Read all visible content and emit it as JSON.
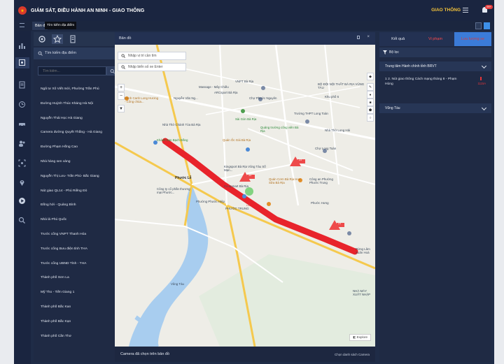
{
  "app": {
    "title": "GIÁM SÁT, ĐIỀU HÀNH AN NINH - GIAO THÔNG",
    "mode_label": "GIAO THÔNG",
    "notification_badge": "99+",
    "colors": {
      "bg": "#1f2c47",
      "accent": "#3b7bd8",
      "route": "#e8232b",
      "warning": "#e8363a"
    }
  },
  "subbar": {
    "tab_map_label": "Bản đ",
    "tab_tooltip": "Tìm kiếm địa điểm"
  },
  "list_panel": {
    "header_label": "Tìm kiếm địa điểm",
    "search_placeholder": "Tìm kiếm...",
    "items": [
      "Ngã tư Xô Viết mới, Phường Trần Phú",
      "Đường Huỳnh Thúc Kháng Hà Nội",
      "Nguyễn Thái Học Hà Giang",
      "Camera đường Quyết Thắng - Hà Giang",
      "Đường Phạm Hồng Cao",
      "Nhà hàng sen vàng",
      "Nguyễn Thị Lưu- Trần Phú- Bắc Giang",
      "Nút giao QL14 - Phú Riềng Đỏ",
      "Đồng hới - Quảng Bình",
      "Nhà lá Phú Quốc",
      "Trước cổng VNPT Thanh Hóa",
      "Trước cổng Bưu điện tỉnh THA",
      "Trước cổng UBND Tỉnh - THA",
      "Thành phố Sơn La",
      "Mỹ Tho - Tiền Giang 1",
      "Thành phố Bắc Kan",
      "Thành phố Bắc Kạn",
      "Thành phố Cần Thơ"
    ]
  },
  "map_panel": {
    "title": "Bản đồ",
    "search_location_placeholder": "Nhập vị trí cần tìm",
    "search_plate_placeholder": "Nhập biển số xe Enter",
    "footer_text": "Camera đã chọn trên bản đồ",
    "footer_link": "Chọn danh sách Camera",
    "explore_label": "Explore",
    "labels": {
      "massage": "Massage - Mây Chiều",
      "arcsport": "ARCsport Bà Rịa",
      "vnpt": "VNPT Bà Rịa",
      "bo_doi": "BỘ ĐỘI NỘI THẤT BÀ RỊA VŨNG TÀU",
      "khu_pho": "Khu phố 6",
      "canh_long": "Bánh Canh Long Hương - Công chúa...",
      "ndnguyen": "Nguyễn Văn Ng...",
      "cho_phuoc": "Chợ Phước Nguyên",
      "nha_tho_chanh": "Nhà Thờ Chánh Tòa Bà Rịa",
      "sai_gon": "Sài Gòn Bà Rịa",
      "thpt": "Trường THPT Long Toàn",
      "khach_san": "Khách Sạn Bạch Đằng",
      "quan_oc": "Quán Ốc Gái Bà Rịa",
      "kingsport": "Kingsport Bà Rịa Vũng Tàu Số Mạn...",
      "quang_truong": "Quảng trường công viên Bà Rịa",
      "cho_long": "Chợ Long Toàn",
      "phuoc_le": "Phước Lễ",
      "coopmart": "Co.opmart Bà Rịa",
      "quan_com": "Quán Cơm Bà Rịa Hoa Sữa Bà Rịa",
      "cong_an": "Công an Phường Phước Trung",
      "phuoc_trung": "PHƯỚC TRUNG",
      "phuong_hiep": "Phường Phước Hiệp",
      "rung_lam": "Rừng Lâm Xuân Hoà",
      "nha_may": "NHÀ MÁY XUẤT NHẬP",
      "cong_ty": "Công ty cổ phần thương mại Phước...",
      "vung_tau_road": "Vũng Tàu",
      "nha_tho_long": "Nhà Thờ Long Hải",
      "phuoc_hung": "Phước Hưng",
      "camera_a": "23",
      "camera_b": "33",
      "camera_c": "23",
      "camera_d": "Lỗi"
    }
  },
  "right_panel": {
    "tabs": [
      "Kết quả",
      "Vi phạm",
      "Lưu lượng xe"
    ],
    "filter_label": "Bộ lọc",
    "group1_label": "Trung tâm Hành chính tỉnh BRVT",
    "entry_text": "1  2. Nút giao thông Cách mạng tháng 8 - Phạm Hùng",
    "entry_dist": "1115A",
    "group2_label": "Vũng Tàu"
  }
}
